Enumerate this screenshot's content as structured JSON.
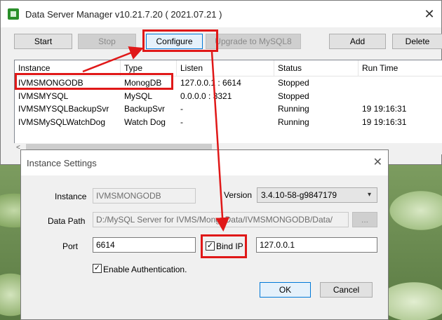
{
  "window": {
    "title": "Data Server Manager v10.21.7.20 ( 2021.07.21 )",
    "close_glyph": "✕"
  },
  "toolbar": {
    "start": "Start",
    "stop": "Stop",
    "configure": "Configure",
    "upgrade": "Upgrade to MySQL8",
    "add": "Add",
    "delete": "Delete"
  },
  "table": {
    "headers": [
      "Instance",
      "Type",
      "Listen",
      "Status",
      "Run Time"
    ],
    "rows": [
      [
        "IVMSMONGODB",
        "MonogDB",
        "127.0.0.1 : 6614",
        "Stopped",
        ""
      ],
      [
        "IVMSMYSQL",
        "MySQL",
        "0.0.0.0 : 3321",
        "Stopped",
        ""
      ],
      [
        "IVMSMYSQLBackupSvr",
        "BackupSvr",
        "-",
        "Running",
        "19 19:16:31"
      ],
      [
        "IVMSMySQLWatchDog",
        "Watch Dog",
        "-",
        "Running",
        "19 19:16:31"
      ]
    ]
  },
  "dialog": {
    "title": "Instance Settings",
    "instance_label": "Instance",
    "instance_value": "IVMSMONGODB",
    "version_label": "Version",
    "version_value": "3.4.10-58-g9847179",
    "datapath_label": "Data Path",
    "datapath_value": "D:/MySQL Server for IVMS/MongoData/IVMSMONGODB/Data/",
    "browse_label": "...",
    "port_label": "Port",
    "port_value": "6614",
    "bindip_label": "Bind IP",
    "bindip_checked": true,
    "bindip_value": "127.0.0.1",
    "auth_label": "Enable Authentication.",
    "auth_checked": true,
    "ok": "OK",
    "cancel": "Cancel"
  },
  "colors": {
    "highlight": "#e01818",
    "accent": "#0078d7"
  }
}
